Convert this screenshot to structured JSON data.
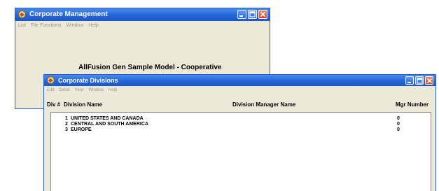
{
  "window1": {
    "title": "Corporate Management",
    "menu": [
      "List",
      "File Functions",
      "Window",
      "Help"
    ],
    "heading": "AllFusion Gen Sample Model - Cooperative"
  },
  "window2": {
    "title": "Corporate Divisions",
    "menu": [
      "Edit",
      "Detail",
      "View",
      "Window",
      "Help"
    ],
    "columns": [
      "Div #",
      "Division Name",
      "Division Manager Name",
      "Mgr Number"
    ],
    "rows": [
      {
        "div": "1",
        "name": "UNITED STATES AND CANADA",
        "manager": "",
        "mgr_number": "0"
      },
      {
        "div": "2",
        "name": "CENTRAL AND SOUTH AMERICA",
        "manager": "",
        "mgr_number": "0"
      },
      {
        "div": "3",
        "name": "EUROPE",
        "manager": "",
        "mgr_number": "0"
      }
    ]
  },
  "colors": {
    "titlebar": "#2566d8",
    "close_button": "#d8431e",
    "window_bg": "#ece9d8"
  }
}
